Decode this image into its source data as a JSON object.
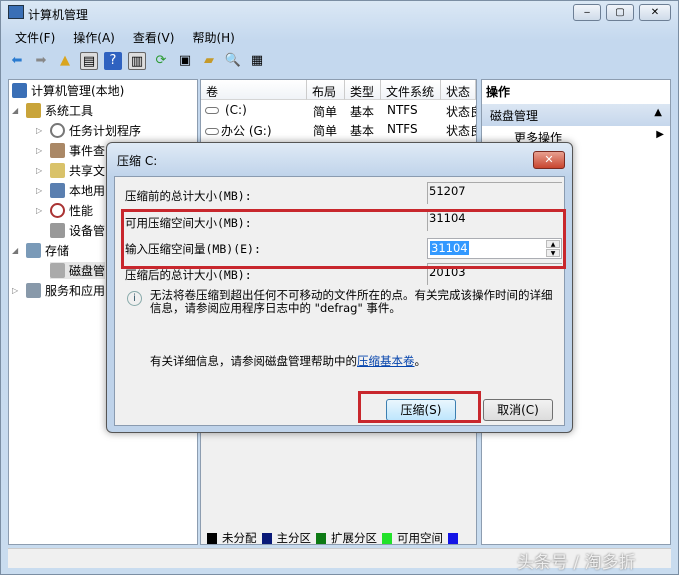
{
  "window": {
    "title": "计算机管理",
    "controls": [
      "‒",
      "▢",
      "✕"
    ]
  },
  "menu": [
    "文件(F)",
    "操作(A)",
    "查看(V)",
    "帮助(H)"
  ],
  "tree": [
    {
      "label": "计算机管理(本地)",
      "level": 0,
      "expander": ""
    },
    {
      "label": "系统工具",
      "level": 1,
      "expander": "◢"
    },
    {
      "label": "任务计划程序",
      "level": 2,
      "expander": "▷"
    },
    {
      "label": "事件查",
      "level": 2,
      "expander": "▷"
    },
    {
      "label": "共享文",
      "level": 2,
      "expander": "▷"
    },
    {
      "label": "本地用",
      "level": 2,
      "expander": "▷"
    },
    {
      "label": "性能",
      "level": 2,
      "expander": "▷"
    },
    {
      "label": "设备管",
      "level": 2,
      "expander": ""
    },
    {
      "label": "存储",
      "level": 1,
      "expander": "◢"
    },
    {
      "label": "磁盘管",
      "level": 2,
      "expander": ""
    },
    {
      "label": "服务和应用",
      "level": 1,
      "expander": "▷"
    }
  ],
  "volumes": {
    "columns": [
      "卷",
      "布局",
      "类型",
      "文件系统",
      "状态"
    ],
    "rows": [
      [
        "(C:)",
        "简单",
        "基本",
        "NTFS",
        "状态良"
      ],
      [
        "办公 (G:)",
        "简单",
        "基本",
        "NTFS",
        "状态良"
      ]
    ]
  },
  "actions": {
    "header": "操作",
    "section": "磁盘管理",
    "more": "更多操作"
  },
  "legend": [
    {
      "label": "未分配",
      "color": "#000000"
    },
    {
      "label": "主分区",
      "color": "#0a1a78"
    },
    {
      "label": "扩展分区",
      "color": "#0d7a14"
    },
    {
      "label": "可用空间",
      "color": "#22e22a"
    },
    {
      "label": "",
      "color": "#1414e6"
    }
  ],
  "dialog": {
    "title": "压缩 C:",
    "fields": [
      {
        "label": "压缩前的总计大小(MB):",
        "value": "51207"
      },
      {
        "label": "可用压缩空间大小(MB):",
        "value": "31104"
      },
      {
        "label": "输入压缩空间量(MB)(E):",
        "value": "31104"
      },
      {
        "label": "压缩后的总计大小(MB):",
        "value": "20103"
      }
    ],
    "info": "无法将卷压缩到超出任何不可移动的文件所在的点。有关完成该操作时间的详细信息，请参阅应用程序日志中的 \"defrag\" 事件。",
    "help_prefix": "有关详细信息，请参阅磁盘管理帮助中的",
    "help_link": "压缩基本卷",
    "help_suffix": "。",
    "ok": "压缩(S)",
    "cancel": "取消(C)"
  },
  "watermark": "头条号 / 淘多折"
}
